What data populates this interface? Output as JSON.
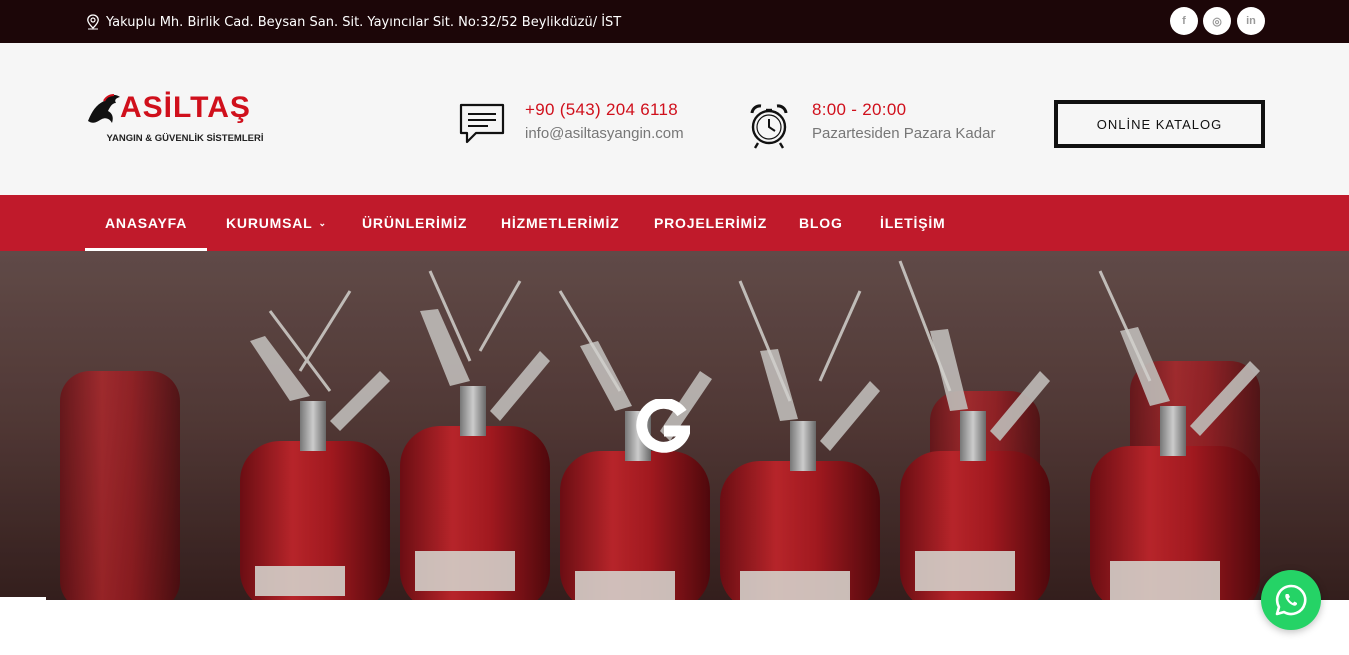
{
  "topbar": {
    "address": "Yakuplu Mh. Birlik Cad. Beysan San. Sit. Yayıncılar Sit. No:32/52 Beylikdüzü/ İST",
    "social": [
      {
        "name": "facebook-icon",
        "glyph": "f"
      },
      {
        "name": "instagram-icon",
        "glyph": "◎"
      },
      {
        "name": "linkedin-icon",
        "glyph": "in"
      }
    ]
  },
  "logo": {
    "brand": "ASİLTAŞ",
    "tagline": "YANGIN & GÜVENLİK SİSTEMLERİ"
  },
  "contact": {
    "phone": "+90 (543) 204 6118",
    "email": "info@asiltasyangin.com"
  },
  "hours": {
    "time": "8:00 - 20:00",
    "days": "Pazartesiden Pazara Kadar"
  },
  "catalog_button": "ONLİNE KATALOG",
  "nav": {
    "items": [
      "ANASAYFA",
      "KURUMSAL",
      "ÜRÜNLERİMİZ",
      "HİZMETLERİMİZ",
      "PROJELERİMİZ",
      "BLOG",
      "İLETİŞİM"
    ],
    "active": "ANASAYFA"
  },
  "colors": {
    "brand_red": "#c01a2b",
    "topbar": "#1c0608",
    "whatsapp": "#25d366"
  }
}
